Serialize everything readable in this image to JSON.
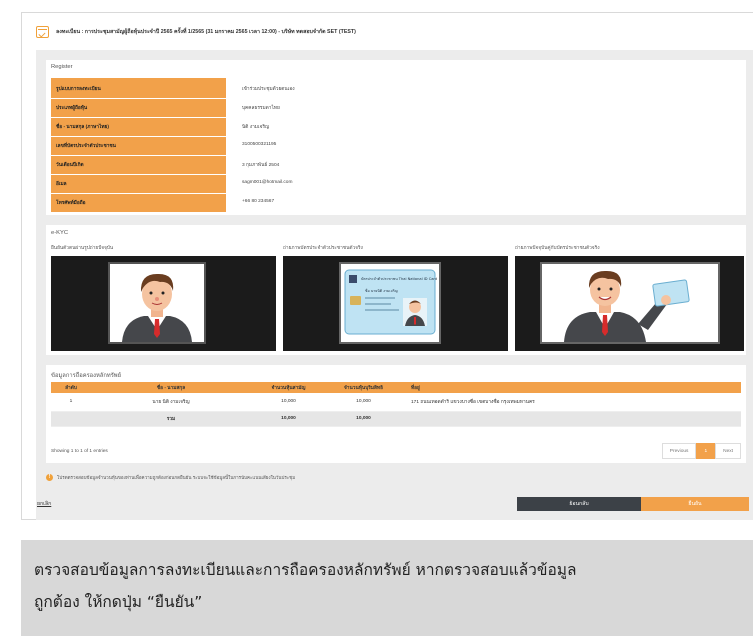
{
  "header": {
    "title": "ลงทะเบียน : การประชุมสามัญผู้ถือหุ้นประจำปี 2565 ครั้งที่ 1/2565 (31 มกราคม 2565 เวลา 12:00) - บริษัท ทดสอบจำกัด SET (TEST)"
  },
  "register": {
    "label": "Register",
    "rows": [
      {
        "k": "รูปแบบการลงทะเบียน",
        "v": "เข้าร่วมประชุมด้วยตนเอง"
      },
      {
        "k": "ประเภทผู้ถือหุ้น",
        "v": "บุคคลธรรมดาไทย"
      },
      {
        "k": "ชื่อ - นามสกุล (ภาษาไทย)",
        "v": "นิติ งามเจริญ"
      },
      {
        "k": "เลขที่บัตรประจำตัวประชาชน",
        "v": "3100500321195"
      },
      {
        "k": "วันเดือนปีเกิด",
        "v": "3 กุมภาพันธ์ 2504"
      },
      {
        "k": "อีเมล",
        "v": "sagm001@hotmail.com"
      },
      {
        "k": "โทรศัพท์มือถือ",
        "v": "+66 80 234567"
      }
    ]
  },
  "ekyc": {
    "label": "e-KYC",
    "captions": [
      "ยืนยันตัวตนผ่านรูปถ่ายปัจจุบัน",
      "ถ่ายภาพบัตรประจำตัวประชาชนตัวจริง",
      "ถ่ายภาพปัจจุบันคู่กับบัตรประชาชนตัวจริง"
    ],
    "card_text": "บัตรประจำตัวประชาชน  Thai National ID Card",
    "card_name": "ชื่อ  นายนิติ งามเจริญ"
  },
  "holdings": {
    "title": "ข้อมูลการถือครองหลักทรัพย์",
    "columns": [
      "ลำดับ",
      "ชื่อ - นามสกุล",
      "จำนวนหุ้นสามัญ",
      "จำนวนหุ้นบุริมสิทธิ",
      "ที่อยู่"
    ],
    "rows": [
      [
        "1",
        "นาย นิติ งามเจริญ",
        "10,000",
        "10,000",
        "171 ถนนเทอดดำริ แขวงบางซื่อ เขตบางซื่อ กรุงเทพมหานคร"
      ]
    ],
    "total": [
      "",
      "รวม",
      "10,000",
      "10,000",
      ""
    ],
    "showing": "Showing 1 to 1 of 1 entries",
    "pager": {
      "prev": "Previous",
      "page": "1",
      "next": "Next"
    }
  },
  "note": "โปรดตรวจสอบข้อมูลจำนวนหุ้นของท่านเพื่อความถูกต้องก่อนกดยืนยัน ระบบจะใช้ข้อมูลนี้ในการนับคะแนนเสียงในวันประชุม",
  "actions": {
    "cancel": "ยกเลิก",
    "back": "ย้อนกลับ",
    "confirm": "ยืนยัน"
  },
  "caption": {
    "line1": "ตรวจสอบข้อมูลการลงทะเบียนและการถือครองหลักทรัพย์ หากตรวจสอบแล้วข้อมูล",
    "line2": "ถูกต้อง ให้กดปุ่ม “ยืนยัน”"
  },
  "colors": {
    "accent": "#f2a14a",
    "dark_button": "#3c4147",
    "caption_bg": "#d8d8d8"
  }
}
